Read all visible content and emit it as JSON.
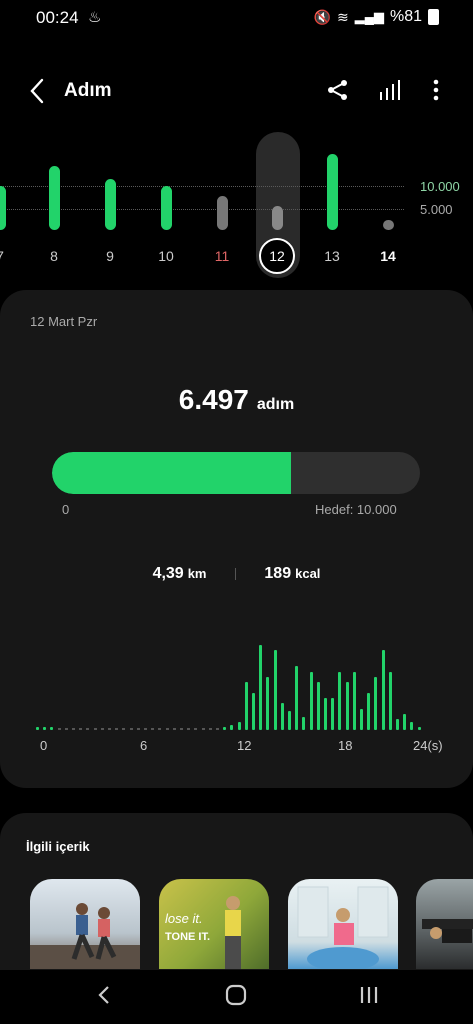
{
  "status": {
    "time": "00:24",
    "battery": "%81"
  },
  "header": {
    "title": "Adım"
  },
  "week": {
    "goal_high": "10.000",
    "goal_low": "5.000",
    "days": [
      {
        "label": "7",
        "level": 0.55,
        "color": "#22d36a"
      },
      {
        "label": "8",
        "level": 0.8,
        "color": "#22d36a"
      },
      {
        "label": "9",
        "level": 0.64,
        "color": "#22d36a"
      },
      {
        "label": "10",
        "level": 0.55,
        "color": "#22d36a"
      },
      {
        "label": "11",
        "level": 0.42,
        "color": "#777777"
      },
      {
        "label": "12",
        "level": 0.3,
        "color": "#888888"
      },
      {
        "label": "13",
        "level": 0.95,
        "color": "#22d36a"
      },
      {
        "label": "14",
        "level": 0.06,
        "color": "#777777"
      }
    ],
    "selected_day": "12"
  },
  "card": {
    "date": "12 Mart Pzr",
    "steps": "6.497",
    "steps_unit": "adım",
    "progress": 0.65,
    "progress_start": "0",
    "goal": "Hedef: 10.000",
    "distance": "4,39",
    "distance_unit": "km",
    "calories": "189",
    "calories_unit": "kcal",
    "hourly_labels": [
      "0",
      "6",
      "12",
      "18",
      "24(s)"
    ]
  },
  "hourly_chart": {
    "type": "bar",
    "values": [
      2,
      2,
      2,
      0,
      0,
      0,
      0,
      0,
      0,
      0,
      0,
      0,
      0,
      0,
      0,
      0,
      0,
      0,
      0,
      0,
      0,
      0,
      0,
      0,
      0,
      0,
      2,
      5,
      8,
      45,
      35,
      80,
      50,
      75,
      25,
      18,
      60,
      12,
      55,
      45,
      30,
      30,
      55,
      45,
      55,
      20,
      35,
      50,
      75,
      55,
      10,
      15,
      8,
      3
    ]
  },
  "related": {
    "title": "İlgili içerik",
    "thumb_texts": [
      "lose it.",
      "TONE IT."
    ]
  },
  "colors": {
    "accent": "#22d36a",
    "card": "#171717",
    "weekend": "#e06666"
  }
}
